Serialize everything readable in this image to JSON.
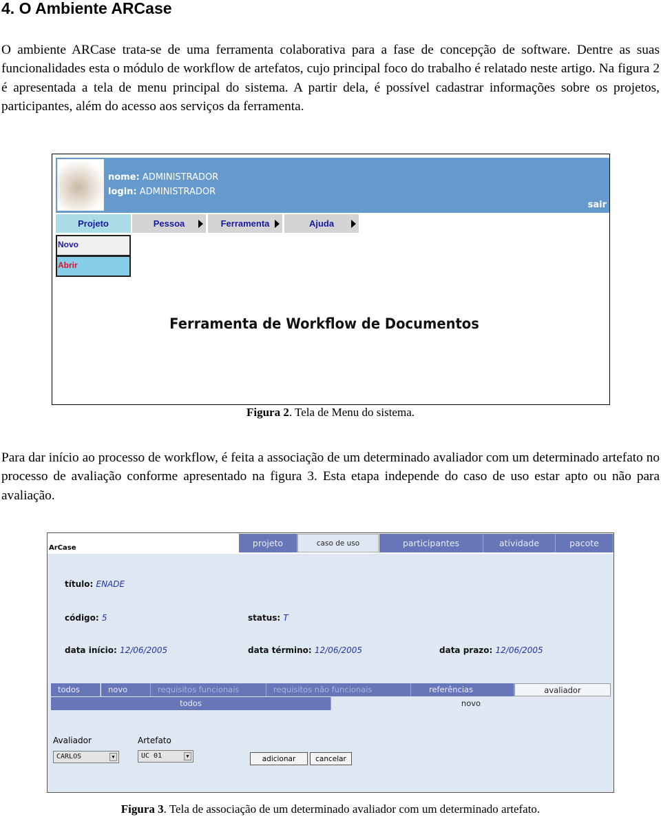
{
  "section_title": "4. O Ambiente ARCase",
  "paragraph1": "O ambiente ARCase trata-se de uma ferramenta colaborativa para a fase de concepção de software. Dentre as suas funcionalidades esta o módulo de workflow de artefatos, cujo principal foco do trabalho é relatado neste artigo. Na figura 2 é apresentada a tela de menu principal do sistema. A partir dela, é possível cadastrar informações sobre os projetos, participantes, além do acesso aos serviços da ferramenta.",
  "figure2": {
    "nome_label": "nome:",
    "nome_value": "ADMINISTRADOR",
    "login_label": "login:",
    "login_value": "ADMINISTRADOR",
    "logout": "sair",
    "menu": [
      "Projeto",
      "Pessoa",
      "Ferramenta",
      "Ajuda"
    ],
    "submenu": [
      "Novo",
      "Abrir"
    ],
    "title": "Ferramenta de Workflow de Documentos",
    "caption_label": "Figura 2",
    "caption_text": ". Tela de Menu do sistema."
  },
  "paragraph2": "Para dar início ao processo de workflow, é feita a associação de um determinado avaliador com um determinado artefato no processo de avaliação conforme apresentado na figura 3. Esta etapa independe do caso de uso estar apto ou não para avaliação.",
  "figure3": {
    "app_name": "ArCase",
    "tabs": [
      "projeto",
      "caso de uso",
      "participantes",
      "atividade",
      "pacote"
    ],
    "active_tab": "caso de uso",
    "titulo_label": "título:",
    "titulo_value": "ENADE",
    "codigo_label": "código:",
    "codigo_value": "5",
    "status_label": "status:",
    "status_value": "T",
    "data_inicio_label": "data início:",
    "data_inicio_value": "12/06/2005",
    "data_termino_label": "data término:",
    "data_termino_value": "12/06/2005",
    "data_prazo_label": "data prazo:",
    "data_prazo_value": "12/06/2005",
    "subtabs": [
      "todos",
      "novo",
      "requisitos funcionais",
      "requisitos não funcionais",
      "referências",
      "avaliador"
    ],
    "subtabs2": [
      "todos",
      "novo"
    ],
    "avaliador_label": "Avaliador",
    "avaliador_value": "CARLOS",
    "artefato_label": "Artefato",
    "artefato_value": "UC 01",
    "add_button": "adicionar",
    "cancel_button": "cancelar",
    "caption_label": "Figura 3",
    "caption_text": ". Tela de associação de um determinado avaliador com um determinado artefato."
  },
  "colors": {
    "header_blue": "#6699cc",
    "tab_blue": "#6676b8",
    "panel_bg": "#dfe8f2",
    "active_menu": "#aadde6",
    "abrir_bg": "#87ceeb"
  }
}
